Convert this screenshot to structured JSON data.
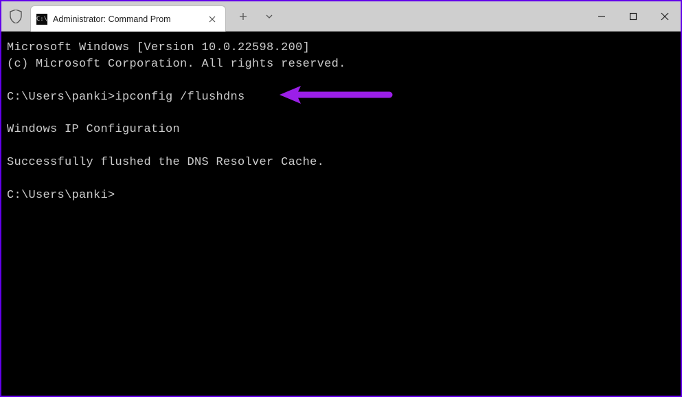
{
  "titlebar": {
    "tab_title": "Administrator: Command Prom",
    "tab_icon_text": "C:\\"
  },
  "terminal": {
    "line1": "Microsoft Windows [Version 10.0.22598.200]",
    "line2": "(c) Microsoft Corporation. All rights reserved.",
    "prompt1": "C:\\Users\\panki>",
    "command1": "ipconfig /flushdns",
    "header": "Windows IP Configuration",
    "result": "Successfully flushed the DNS Resolver Cache.",
    "prompt2": "C:\\Users\\panki>"
  },
  "annotation": {
    "arrow_color": "#8a2be2"
  }
}
